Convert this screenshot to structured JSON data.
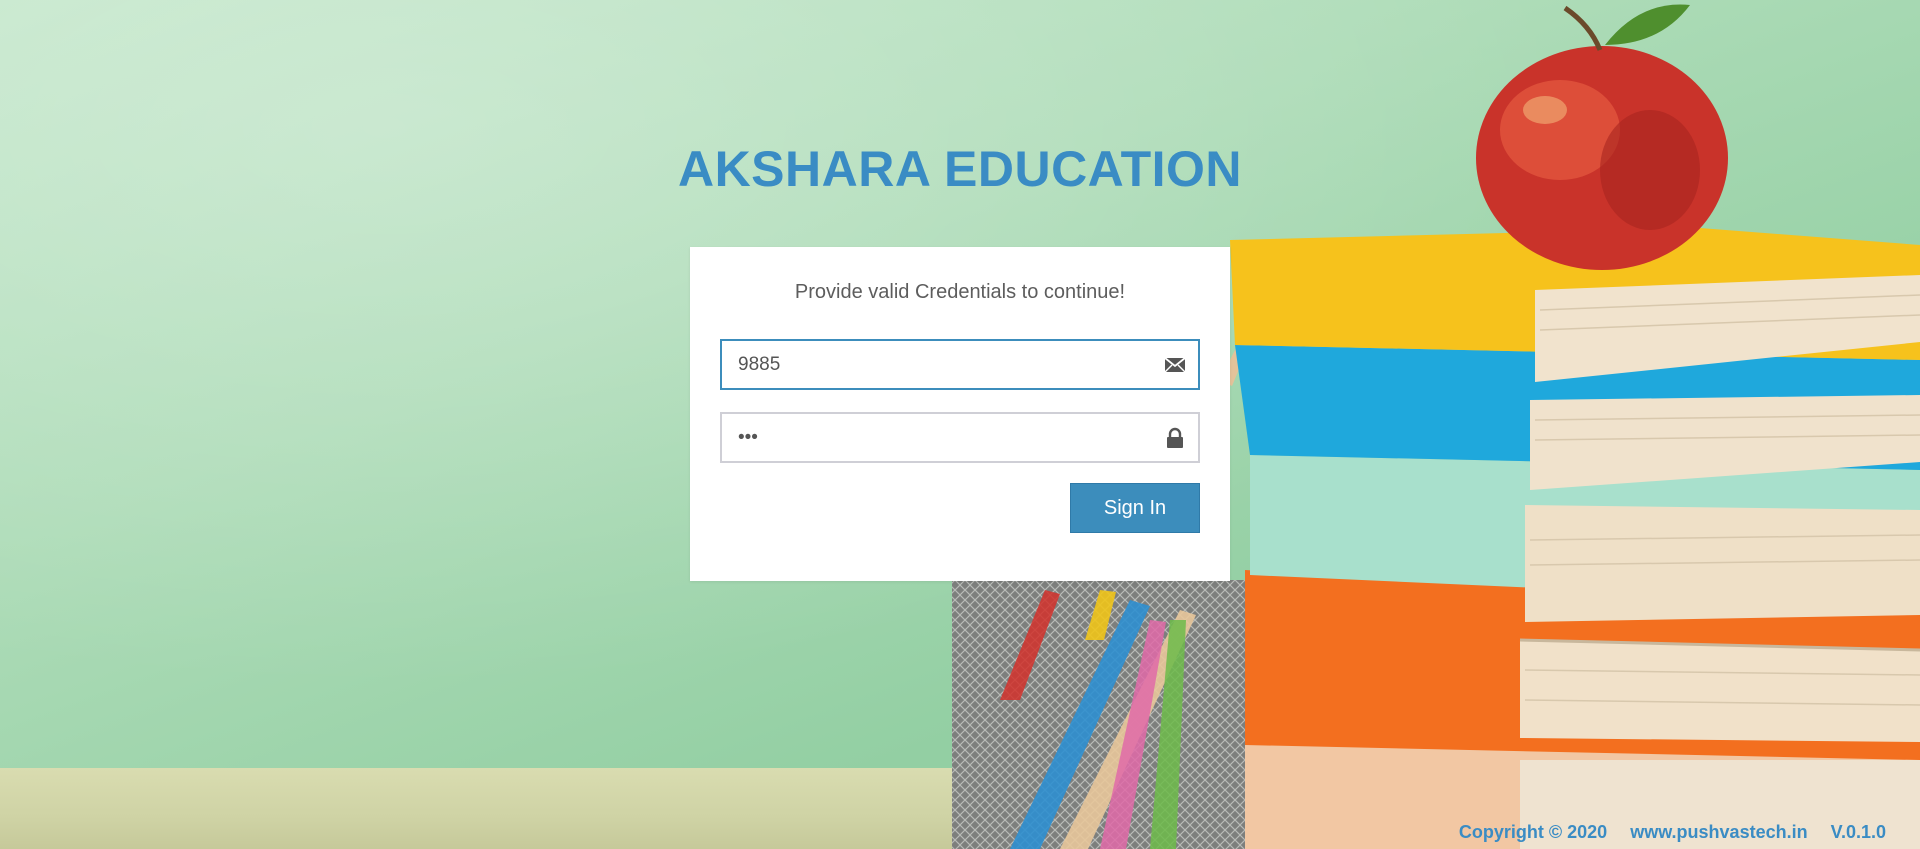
{
  "app": {
    "title": "AKSHARA EDUCATION"
  },
  "login": {
    "message": "Provide valid Credentials to continue!",
    "username": {
      "value": "9885",
      "placeholder": "",
      "icon": "envelope-icon"
    },
    "password": {
      "value": "•••",
      "placeholder": "",
      "icon": "lock-icon"
    },
    "signin_label": "Sign In"
  },
  "footer": {
    "copyright": "Copyright © 2020",
    "website": "www.pushvastech.in",
    "version": "V.0.1.0"
  },
  "colors": {
    "accent": "#3c8dbc",
    "brand_text": "#3a8cc4",
    "background": "#aedcb8"
  }
}
